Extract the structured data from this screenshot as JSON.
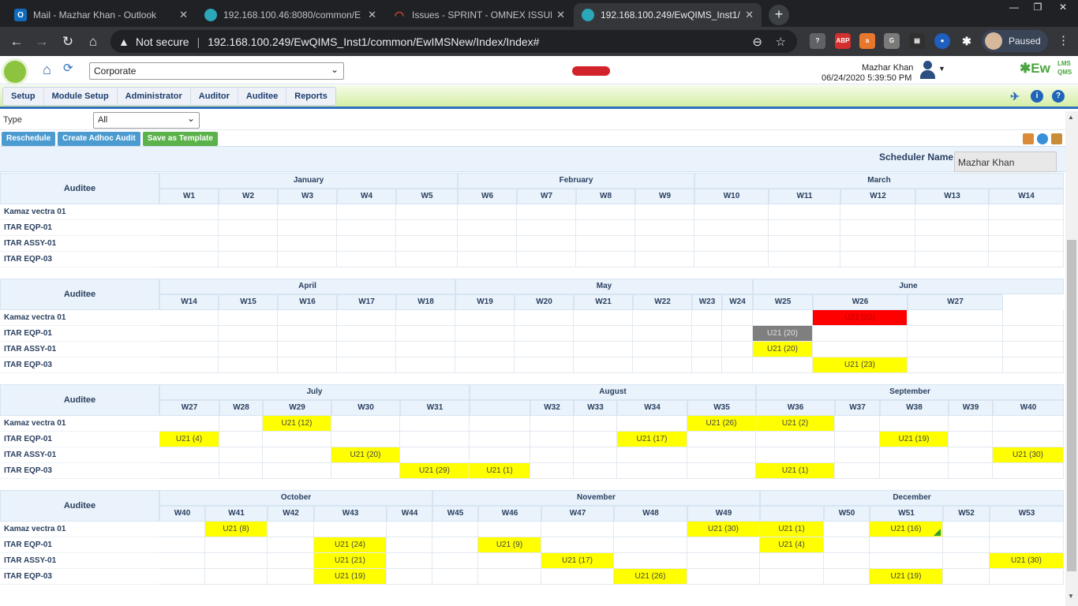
{
  "browser": {
    "tabs": [
      {
        "title": "Mail - Mazhar Khan - Outlook",
        "icon": "outlook-icon",
        "color": "#0f6cbd"
      },
      {
        "title": "192.168.100.46:8080/common/E",
        "icon": "ewqims-icon",
        "color": "#2aa7b8"
      },
      {
        "title": "Issues - SPRINT - OMNEX ISSUE",
        "icon": "jira-icon",
        "color": "#d04437"
      },
      {
        "title": "192.168.100.249/EwQIMS_Inst1/",
        "icon": "ewqims-icon",
        "color": "#2aa7b8"
      }
    ],
    "not_secure": "Not secure",
    "url": "192.168.100.249/EwQIMS_Inst1/common/EwIMSNew/Index/Index#",
    "profile": "Paused"
  },
  "header": {
    "company_select": "Corporate",
    "user_name": "Mazhar Khan",
    "datetime": "06/24/2020 5:39:50 PM",
    "logo_text": "Ew",
    "logo_lms": "LMS",
    "logo_qms": "QMS"
  },
  "menu": [
    "Setup",
    "Module Setup",
    "Administrator",
    "Auditor",
    "Auditee",
    "Reports"
  ],
  "filter": {
    "label": "Type",
    "value": "All"
  },
  "actions": {
    "reschedule": "Reschedule",
    "adhoc": "Create Adhoc Audit",
    "template": "Save as Template"
  },
  "scheduler": {
    "label": "Scheduler Name",
    "value": "Mazhar Khan"
  },
  "auditee_header": "Auditee",
  "auditees": [
    "Kamaz vectra 01",
    "ITAR EQP-01",
    "ITAR ASSY-01",
    "ITAR EQP-03"
  ],
  "colors": {
    "yellow": "#ffff00",
    "red": "#ff0000",
    "gray": "#7f7f7f"
  },
  "blocks": [
    {
      "months": [
        {
          "name": "January",
          "span": 5
        },
        {
          "name": "February",
          "span": 4
        },
        {
          "name": "March",
          "span": 5
        }
      ],
      "weeks": [
        "W1",
        "W2",
        "W3",
        "W4",
        "W5",
        "W6",
        "W7",
        "W8",
        "W9",
        "W10",
        "W11",
        "W12",
        "W13",
        "W14"
      ],
      "rows": [
        [],
        [],
        [],
        []
      ]
    },
    {
      "months": [
        {
          "name": "April",
          "span": 5
        },
        {
          "name": "May",
          "span": 5
        },
        {
          "name": "June",
          "span": 4
        }
      ],
      "weeks": [
        "W14",
        "W15",
        "W16",
        "W17",
        "W18",
        "W19",
        "W20",
        "W21",
        "W22",
        "W23",
        "W24",
        "W25",
        "W26",
        "W27"
      ],
      "rows": [
        [
          {
            "week": 12,
            "label": "U21 (22)",
            "color": "red"
          }
        ],
        [
          {
            "week": 11,
            "label": "U21 (20)",
            "color": "gray"
          }
        ],
        [
          {
            "week": 11,
            "label": "U21 (20)",
            "color": "yellow"
          }
        ],
        [
          {
            "week": 12,
            "label": "U21 (23)",
            "color": "yellow"
          }
        ]
      ]
    },
    {
      "months": [
        {
          "name": "July",
          "span": 5
        },
        {
          "name": "August",
          "span": 5
        },
        {
          "name": "September",
          "span": 5
        }
      ],
      "weeks": [
        "W27",
        "W28",
        "W29",
        "W30",
        "W31",
        "",
        "W32",
        "W33",
        "W34",
        "W35",
        "W36",
        "W37",
        "W38",
        "W39",
        "W40"
      ],
      "rows": [
        [
          {
            "week": 2,
            "label": "U21 (12)",
            "color": "yellow"
          },
          {
            "week": 9,
            "label": "U21 (26)",
            "color": "yellow"
          },
          {
            "week": 10,
            "label": "U21 (2)",
            "color": "yellow"
          }
        ],
        [
          {
            "week": 0,
            "label": "U21 (4)",
            "color": "yellow"
          },
          {
            "week": 8,
            "label": "U21 (17)",
            "color": "yellow"
          },
          {
            "week": 12,
            "label": "U21 (19)",
            "color": "yellow"
          }
        ],
        [
          {
            "week": 3,
            "label": "U21 (20)",
            "color": "yellow"
          },
          {
            "week": 14,
            "label": "U21 (30)",
            "color": "yellow"
          }
        ],
        [
          {
            "week": 4,
            "label": "U21 (29)",
            "color": "yellow"
          },
          {
            "week": 5,
            "label": "U21 (1)",
            "color": "yellow"
          },
          {
            "week": 10,
            "label": "U21 (1)",
            "color": "yellow"
          }
        ]
      ]
    },
    {
      "months": [
        {
          "name": "October",
          "span": 5
        },
        {
          "name": "November",
          "span": 5
        },
        {
          "name": "December",
          "span": 5
        }
      ],
      "weeks": [
        "W40",
        "W41",
        "W42",
        "W43",
        "W44",
        "W45",
        "W46",
        "W47",
        "W48",
        "W49",
        "",
        "W50",
        "W51",
        "W52",
        "W53"
      ],
      "rows": [
        [
          {
            "week": 1,
            "label": "U21 (8)",
            "color": "yellow"
          },
          {
            "week": 9,
            "label": "U21 (30)",
            "color": "yellow"
          },
          {
            "week": 10,
            "label": "U21 (1)",
            "color": "yellow"
          },
          {
            "week": 12,
            "label": "U21 (16)",
            "color": "yellow",
            "flag": true
          }
        ],
        [
          {
            "week": 3,
            "label": "U21 (24)",
            "color": "yellow"
          },
          {
            "week": 6,
            "label": "U21 (9)",
            "color": "yellow"
          },
          {
            "week": 10,
            "label": "U21 (4)",
            "color": "yellow"
          }
        ],
        [
          {
            "week": 3,
            "label": "U21 (21)",
            "color": "yellow"
          },
          {
            "week": 7,
            "label": "U21 (17)",
            "color": "yellow"
          },
          {
            "week": 14,
            "label": "U21 (30)",
            "color": "yellow"
          }
        ],
        [
          {
            "week": 3,
            "label": "U21 (19)",
            "color": "yellow"
          },
          {
            "week": 8,
            "label": "U21 (26)",
            "color": "yellow"
          },
          {
            "week": 12,
            "label": "U21 (19)",
            "color": "yellow"
          }
        ]
      ]
    }
  ]
}
